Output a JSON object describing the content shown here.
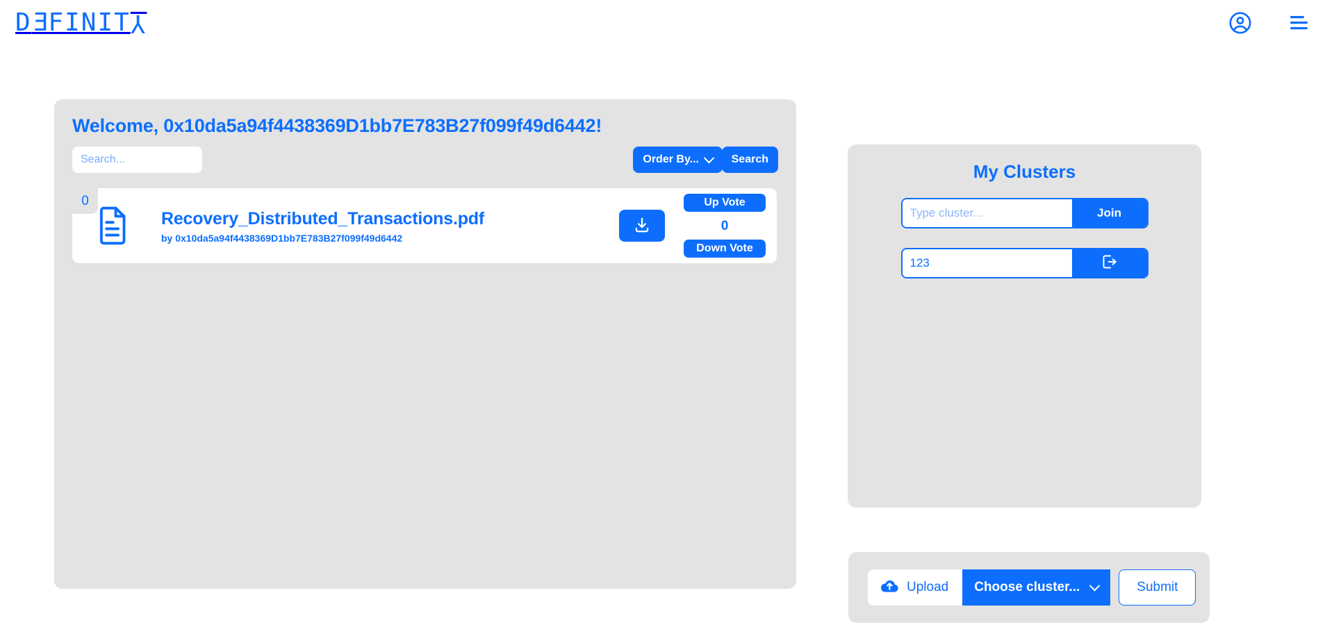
{
  "header": {
    "brand": "DEFINITY",
    "account_icon": "user-circle-icon",
    "menu_icon": "hamburger-menu-icon"
  },
  "files_panel": {
    "welcome_title": "Welcome, 0x10da5a94f4438369D1bb7E783B27f099f49d6442!",
    "search_placeholder": "Search...",
    "search_value": "",
    "order_by_label": "Order By...",
    "search_button_label": "Search",
    "files": [
      {
        "rank": "0",
        "name": "Recovery_Distributed_Transactions.pdf",
        "author": "by 0x10da5a94f4438369D1bb7E783B27f099f49d6442",
        "download_icon": "download-icon",
        "up_vote_label": "Up Vote",
        "vote_count": "0",
        "down_vote_label": "Down Vote"
      }
    ]
  },
  "clusters_panel": {
    "title": "My Clusters",
    "join_row": {
      "placeholder": "Type cluster...",
      "value": "",
      "action_label": "Join"
    },
    "joined_rows": [
      {
        "value": "123",
        "action_icon": "leave-cluster-icon",
        "action_label": ""
      }
    ]
  },
  "upload_panel": {
    "upload_label": "Upload",
    "upload_icon": "cloud-upload-icon",
    "choose_cluster_label": "Choose cluster...",
    "submit_label": "Submit"
  },
  "colors": {
    "primary": "#0d6efd",
    "panel_bg": "#e3e3e3",
    "page_bg": "#ffffff"
  }
}
